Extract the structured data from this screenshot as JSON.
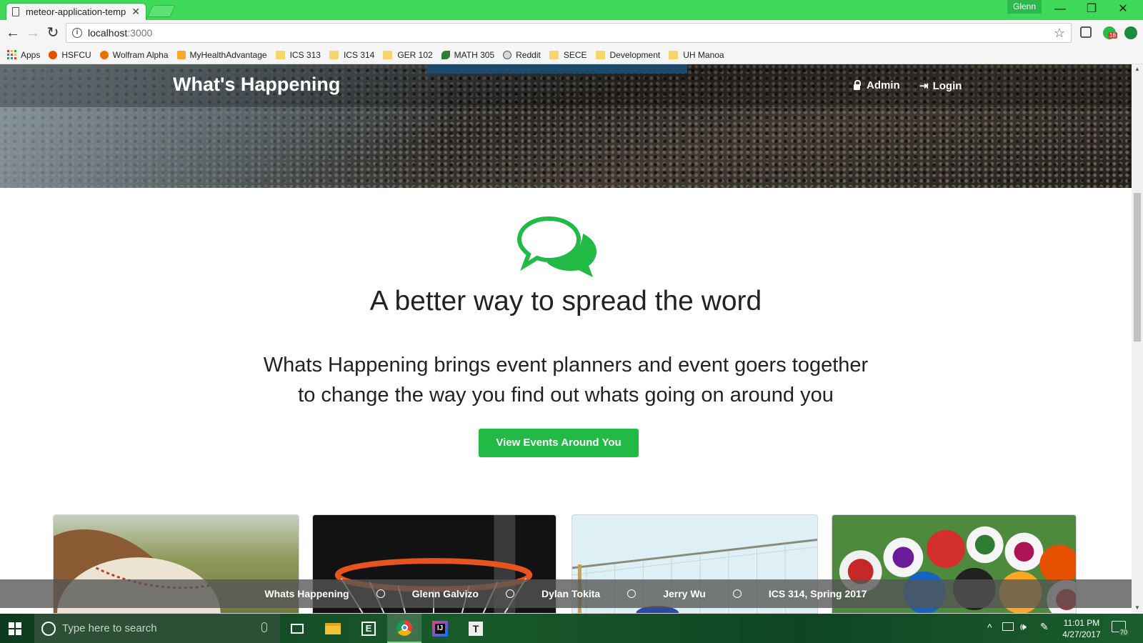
{
  "browser": {
    "tab_title": "meteor-application-temp",
    "tab_close": "✕",
    "profile_name": "Glenn",
    "window_controls": [
      "—",
      "❐",
      "✕"
    ],
    "nav": {
      "back": "←",
      "forward": "→",
      "reload": "↻"
    },
    "url_host": "localhost",
    "url_port": ":3000",
    "info_glyph": "i",
    "star": "☆",
    "ext_badge": "16",
    "bookmarks": [
      {
        "label": "Apps",
        "icon": "apps-grid"
      },
      {
        "label": "HSFCU",
        "icon": "hsfcu-icon"
      },
      {
        "label": "Wolfram Alpha",
        "icon": "wolfram-icon"
      },
      {
        "label": "MyHealthAdvantage",
        "icon": "myhealth-icon"
      },
      {
        "label": "ICS 313",
        "icon": "folder"
      },
      {
        "label": "ICS 314",
        "icon": "folder"
      },
      {
        "label": "GER 102",
        "icon": "folder"
      },
      {
        "label": "MATH 305",
        "icon": "math-icon"
      },
      {
        "label": "Reddit",
        "icon": "reddit-icon"
      },
      {
        "label": "SECE",
        "icon": "folder"
      },
      {
        "label": "Development",
        "icon": "folder"
      },
      {
        "label": "UH Manoa",
        "icon": "folder"
      }
    ]
  },
  "page": {
    "brand": "What's Happening",
    "nav": {
      "admin": "Admin",
      "login": "Login"
    },
    "headline": "A better way to spread the word",
    "lead_line1": "Whats Happening brings event planners and event goers together",
    "lead_line2": "to change the way you find out whats going on around you",
    "cta": "View Events Around You",
    "cards": [
      "baseball",
      "basketball",
      "volleyball",
      "billiards"
    ],
    "footer": [
      "Whats Happening",
      "Glenn Galvizo",
      "Dylan Tokita",
      "Jerry Wu",
      "ICS 314, Spring 2017"
    ],
    "colors": {
      "accent": "#21ba45",
      "tab_green": "#3fd959"
    }
  },
  "taskbar": {
    "search_placeholder": "Type here to search",
    "time": "11:01 PM",
    "date": "4/27/2017",
    "notifications": "70",
    "apps": [
      "task-view-icon",
      "file-explorer-icon",
      "editor-icon",
      "chrome-icon",
      "intellij-icon",
      "typora-icon"
    ]
  }
}
